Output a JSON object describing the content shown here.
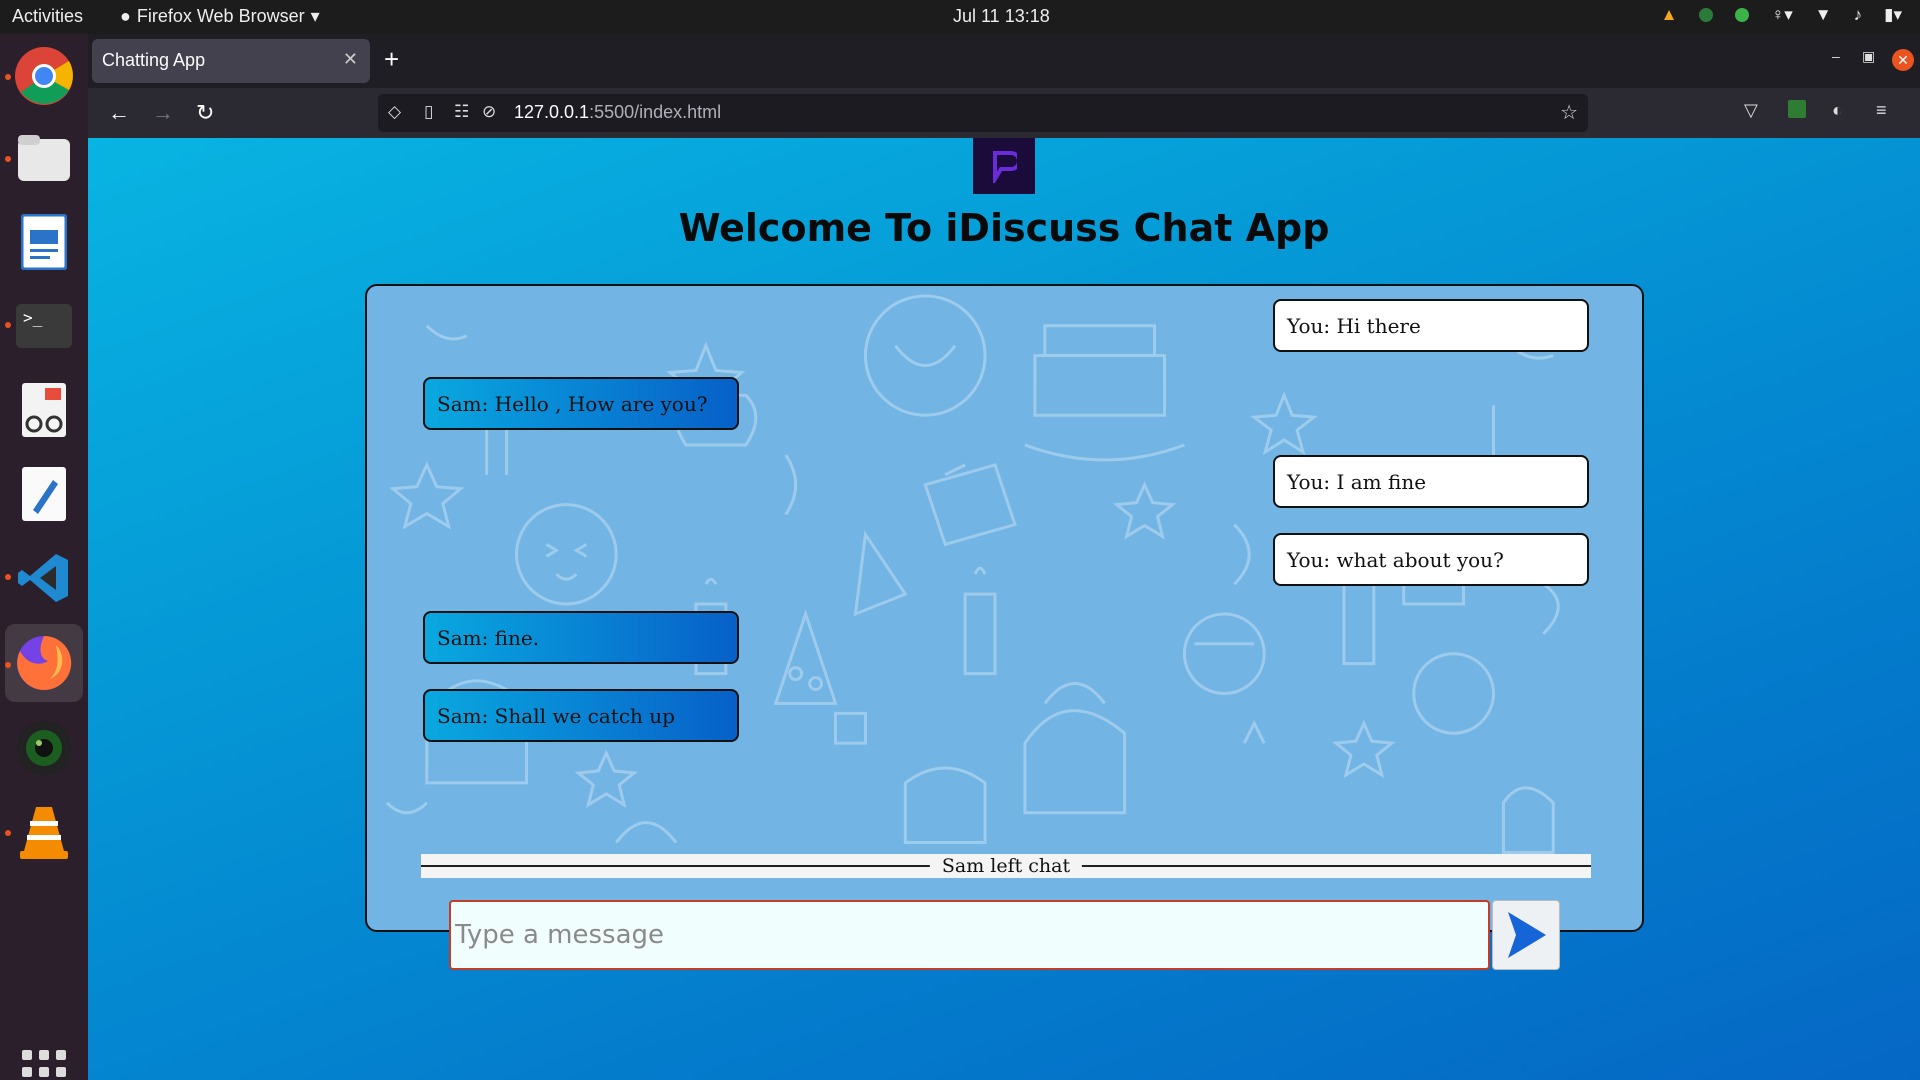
{
  "topbar": {
    "activities": "Activities",
    "app_menu": "Firefox Web Browser",
    "clock": "Jul 11  13:18"
  },
  "dock": {
    "items": [
      "chrome-icon",
      "files-icon",
      "writer-icon",
      "terminal-icon",
      "document-viewer-icon",
      "text-editor-icon",
      "vscode-icon",
      "firefox-icon",
      "camera-icon",
      "vlc-icon"
    ]
  },
  "browser": {
    "tab_title": "Chatting App",
    "url_host": "127.0.0.1",
    "url_path": ":5500/index.html"
  },
  "page": {
    "title": "Welcome To iDiscuss Chat App",
    "messages": [
      {
        "side": "right",
        "text": "You: Hi there"
      },
      {
        "side": "left",
        "text": "Sam: Hello , How are you?"
      },
      {
        "side": "right",
        "text": "You: I am fine"
      },
      {
        "side": "right",
        "text": "You: what about you?"
      },
      {
        "side": "left",
        "text": "Sam: fine."
      },
      {
        "side": "left",
        "text": "Sam: Shall we catch up"
      }
    ],
    "status_message": "Sam left chat",
    "input": {
      "placeholder": "Type a message",
      "value": ""
    }
  },
  "colors": {
    "accent": "#e95420",
    "page_gradient_start": "#08b4e2",
    "page_gradient_end": "#0567c4",
    "chat_background": "#72b4e3",
    "incoming_bubble_start": "#09a8e0",
    "incoming_bubble_end": "#0760c8",
    "outgoing_bubble": "#ffffff"
  }
}
